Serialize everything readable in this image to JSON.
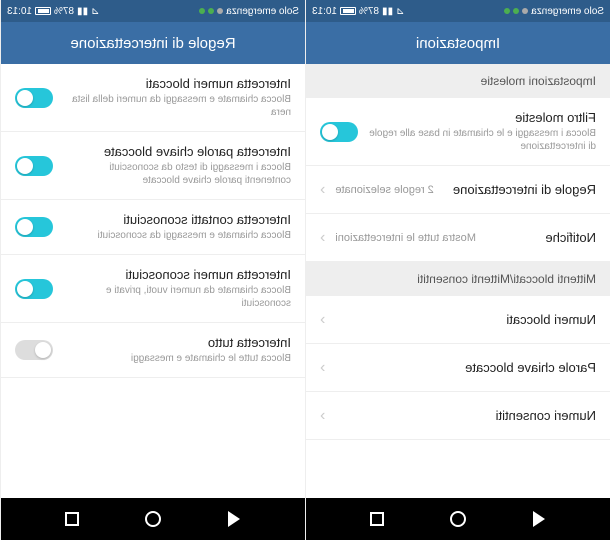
{
  "status": {
    "emergency": "Solo emergenza",
    "time": "10:13",
    "battery_pct": "87%"
  },
  "left_screen": {
    "header": "Impostazioni",
    "section_harassment": "Impostazioni molestie",
    "filter": {
      "title": "Filtro molestie",
      "desc": "Blocca i messaggi e le chiamate in base alle regole di intercettazione",
      "enabled": true
    },
    "rules": {
      "title": "Regole di intercettazione",
      "value": "2 regole selezionate"
    },
    "notifications": {
      "title": "Notifiche",
      "value": "Mostra tutte le intercettazioni"
    },
    "section_allowed": "Mittenti bloccati/Mittenti consentiti",
    "blocked_numbers": "Numeri bloccati",
    "blocked_keywords": "Parole chiave bloccate",
    "allowed_numbers": "Numeri consentiti"
  },
  "right_screen": {
    "header": "Regole di intercettazione",
    "intercept_blocked": {
      "title": "Intercetta numeri bloccati",
      "desc": "Blocca chiamate e messaggi da numeri della lista nera",
      "enabled": true
    },
    "intercept_keywords": {
      "title": "Intercetta parole chiave bloccate",
      "desc": "Blocca i messaggi di testo da sconosciuti contenenti parole chiave bloccate",
      "enabled": true
    },
    "intercept_unknown_contacts": {
      "title": "Intercetta contatti sconosciuti",
      "desc": "Blocca chiamate e messaggi da sconosciuti",
      "enabled": true
    },
    "intercept_unknown_numbers": {
      "title": "Intercetta numeri sconosciuti",
      "desc": "Blocca chiamate da numeri vuoti, privati e sconosciuti",
      "enabled": true
    },
    "intercept_all": {
      "title": "Intercetta tutto",
      "desc": "Blocca tutte le chiamate e messaggi",
      "enabled": false
    }
  }
}
